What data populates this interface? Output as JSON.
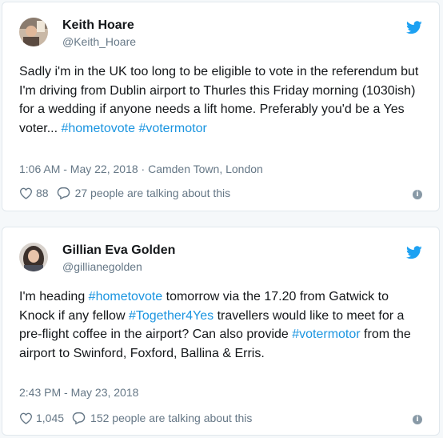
{
  "tweets": [
    {
      "name": "Keith Hoare",
      "handle": "@Keith_Hoare",
      "text_parts": [
        "Sadly i'm in the UK too long to be eligible to vote in the referendum but I'm driving from Dublin airport to Thurles this Friday morning (1030ish) for a wedding if anyone needs a lift home. Preferably you'd be a Yes voter... ",
        "#hometovote",
        " ",
        "#votermotor"
      ],
      "meta": "1:06 AM - May 22, 2018 · Camden Town, London",
      "likes": "88",
      "talking": "27 people are talking about this"
    },
    {
      "name": "Gillian Eva Golden",
      "handle": "@gillianegolden",
      "text_parts": [
        "I'm heading ",
        "#hometovote",
        " tomorrow via the 17.20 from Gatwick to Knock if any fellow ",
        "#Together4Yes",
        " travellers would like to meet for a pre-flight coffee in the airport? Can also provide ",
        "#votermotor",
        " from the airport to Swinford, Foxford, Ballina & Erris."
      ],
      "meta": "2:43 PM - May 23, 2018",
      "likes": "1,045",
      "talking": "152 people are talking about this"
    }
  ],
  "colors": {
    "link": "#1b95e0",
    "twitter_blue": "#1da1f2",
    "muted": "#657786"
  },
  "icons": [
    "twitter-bird-icon",
    "heart-icon",
    "reply-bubble-icon",
    "info-icon"
  ]
}
